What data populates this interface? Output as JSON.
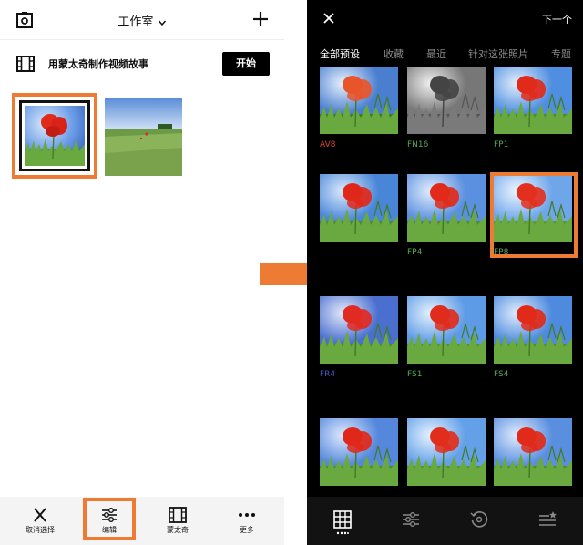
{
  "left_panel": {
    "title": "工作室",
    "montage_prompt": "用蒙太奇制作视频故事",
    "start_button": "开始",
    "bottom_bar": [
      {
        "label": "取消选择",
        "icon": "close-icon"
      },
      {
        "label": "编辑",
        "icon": "sliders-icon"
      },
      {
        "label": "蒙太奇",
        "icon": "film-icon"
      },
      {
        "label": "更多",
        "icon": "more-icon"
      }
    ]
  },
  "right_panel": {
    "next_label": "下一个",
    "tabs": [
      {
        "label": "全部预设",
        "active": true
      },
      {
        "label": "收藏",
        "active": false
      },
      {
        "label": "最近",
        "active": false
      },
      {
        "label": "针对这张照片",
        "active": false
      },
      {
        "label": "专题",
        "active": false
      }
    ],
    "presets": [
      {
        "label": "AV8",
        "label_color": "#e8433a"
      },
      {
        "label": "FN16",
        "label_color": "#56a857"
      },
      {
        "label": "FP1",
        "label_color": "#56a857"
      },
      {
        "label": "",
        "label_color": "#56a857"
      },
      {
        "label": "FP4",
        "label_color": "#56a857"
      },
      {
        "label": "FP8",
        "label_color": "#56a857"
      },
      {
        "label": "FR4",
        "label_color": "#4b57c8"
      },
      {
        "label": "FS1",
        "label_color": "#56a857"
      },
      {
        "label": "FS4",
        "label_color": "#56a857"
      },
      {
        "label": "",
        "label_color": "#56a857"
      },
      {
        "label": "",
        "label_color": "#56a857"
      },
      {
        "label": "",
        "label_color": "#56a857"
      }
    ],
    "bottom_icons": [
      "grid-icon",
      "adjust-icon",
      "history-icon",
      "recipes-icon"
    ]
  },
  "colors": {
    "highlight": "#ee7b34",
    "poppy_red": "#e12a1a",
    "sky_blue": "#5b8fe0",
    "grass_green": "#4f8c2f"
  }
}
